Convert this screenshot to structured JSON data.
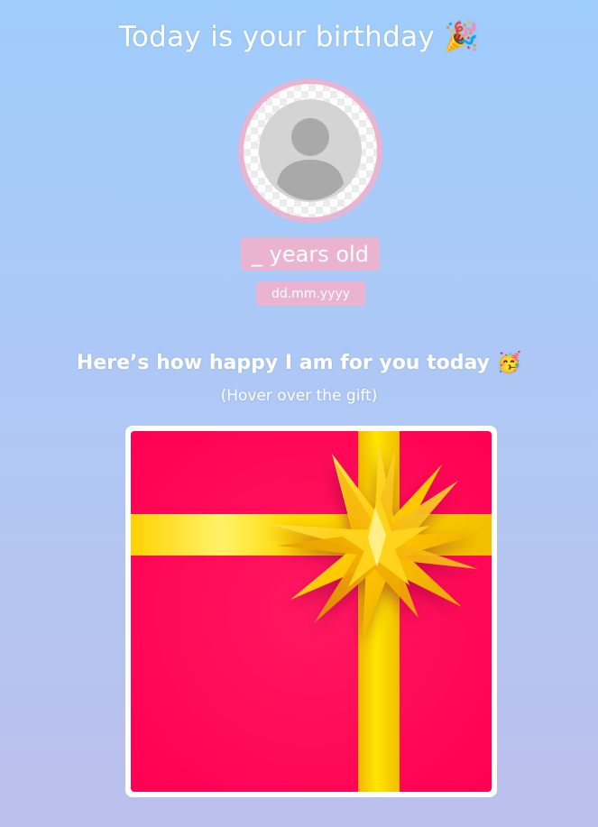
{
  "header": {
    "title": "Today is your birthday 🎉"
  },
  "profile": {
    "avatar_icon": "user-placeholder-icon",
    "age_label": "_ years old",
    "date_label": "dd.mm.yyyy"
  },
  "message": {
    "subtitle": "Here’s how happy I am for you today 🥳",
    "hint": "(Hover over the gift)"
  },
  "gift": {
    "icon": "gift-box-icon",
    "colors": {
      "box": "#ff0052",
      "ribbon": "#ffd400",
      "ring": "#eab3cf"
    }
  }
}
